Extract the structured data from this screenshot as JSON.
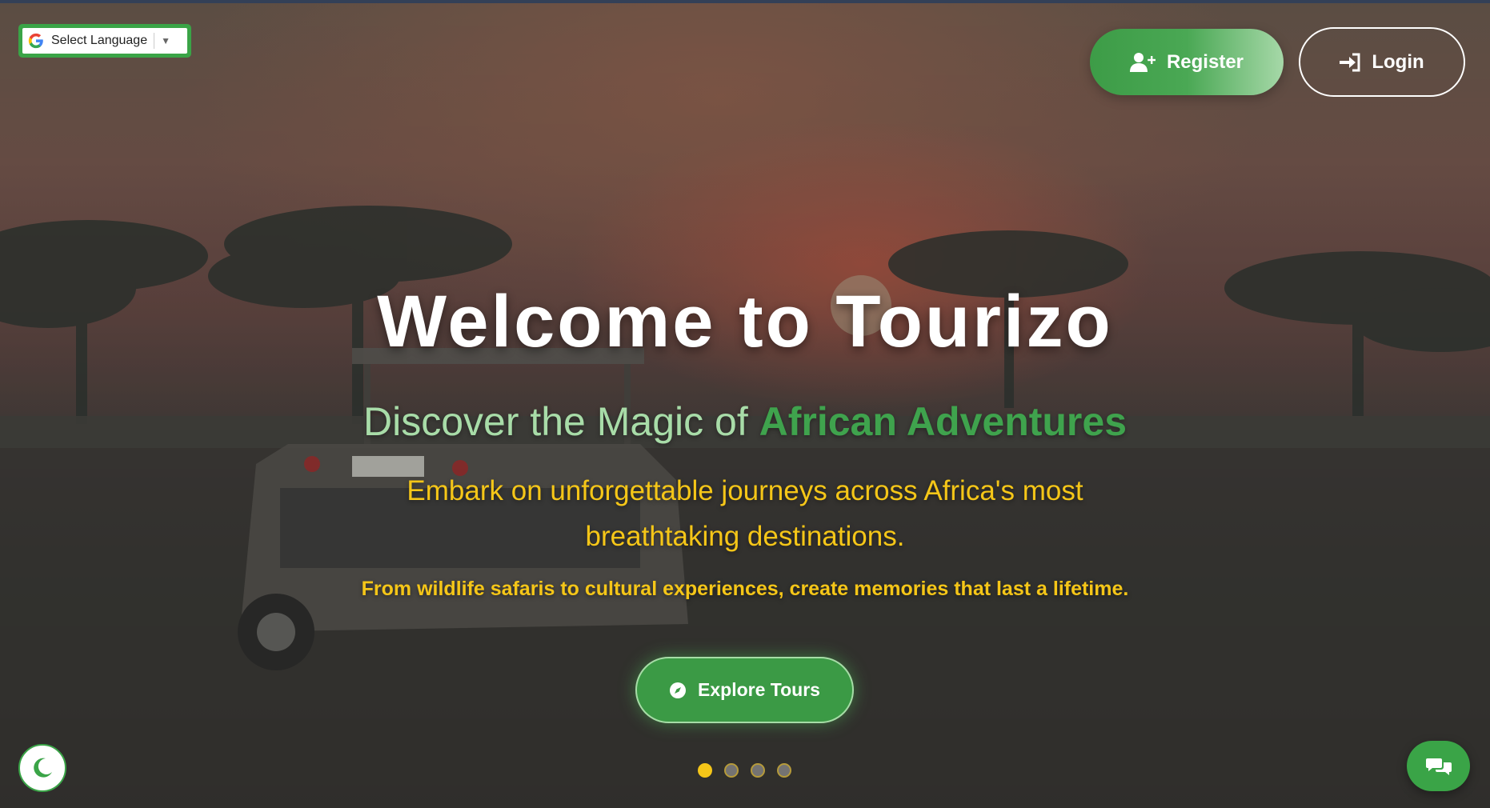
{
  "language": {
    "label": "Select Language",
    "caret": "▼"
  },
  "nav": {
    "register_label": "Register",
    "login_label": "Login"
  },
  "hero": {
    "title": "Welcome to Tourizo",
    "subtitle_prefix": "Discover the Magic of ",
    "subtitle_accent": "African Adventures",
    "lead": "Embark on unforgettable journeys across Africa's most breathtaking destinations.",
    "tagline": "From wildlife safaris to cultural experiences, create memories that last a lifetime.",
    "cta_label": "Explore Tours"
  },
  "carousel": {
    "slides": 4,
    "active": 1
  },
  "icons": {
    "register": "user-plus-icon",
    "login": "sign-in-icon",
    "explore": "compass-icon",
    "theme": "moon-icon",
    "chat": "chat-icon"
  },
  "colors": {
    "brand_green": "#3aa447",
    "accent_green": "#3fa34d",
    "light_green": "#a8dca8",
    "yellow": "#f5c618"
  }
}
